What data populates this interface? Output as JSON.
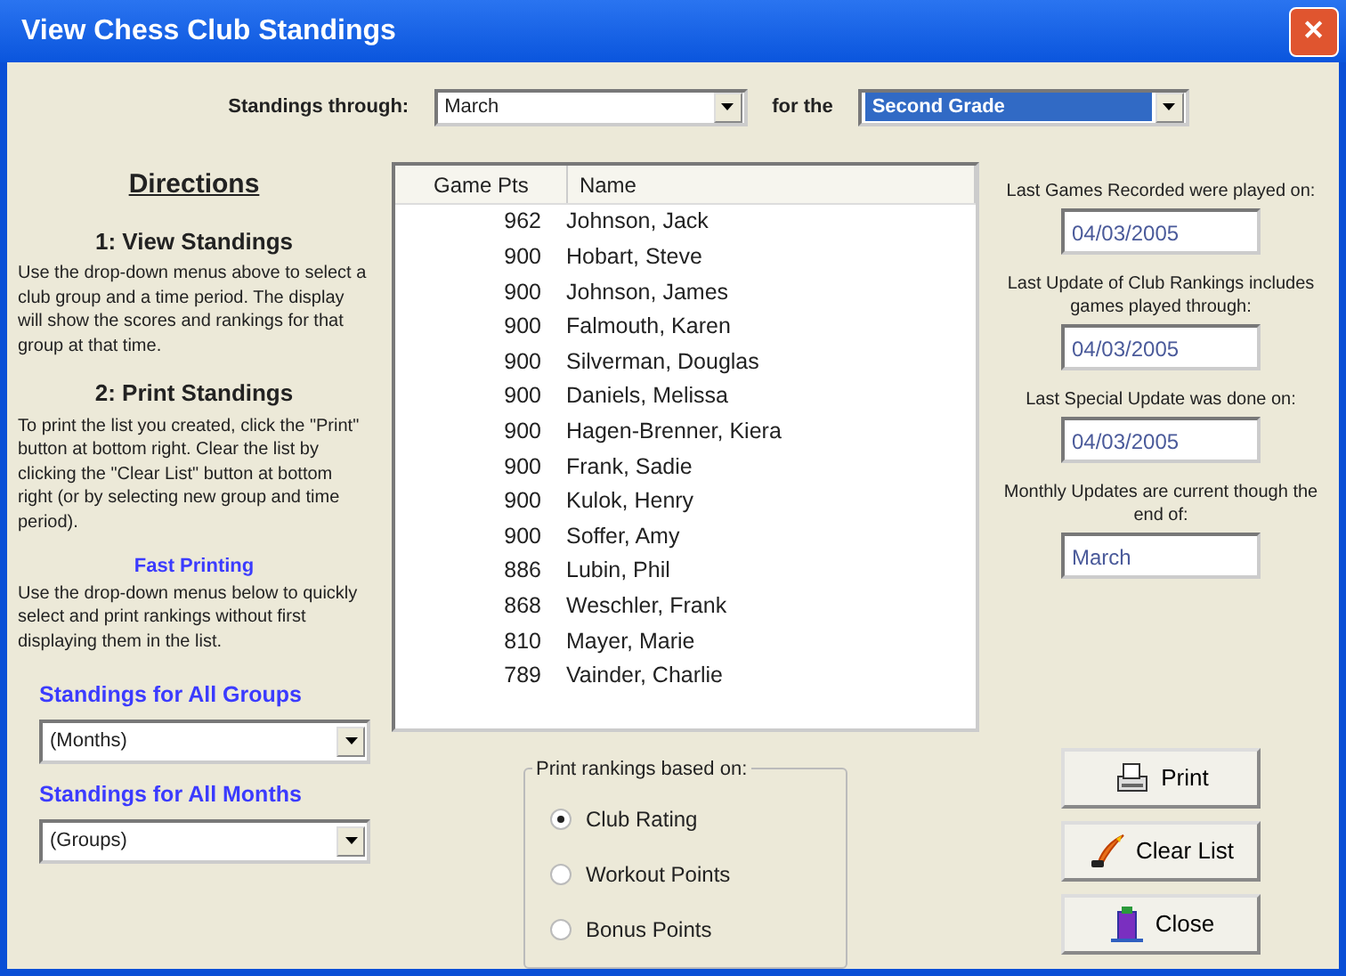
{
  "window": {
    "title": "View Chess Club Standings",
    "close": "✕"
  },
  "filters": {
    "through_label": "Standings through:",
    "through_value": "March",
    "for_label": "for the",
    "group_value": "Second Grade",
    "group_focused": true
  },
  "directions": {
    "title": "Directions",
    "sections": [
      {
        "heading": "1: View Standings",
        "text": "Use the drop-down menus above to select a club group and a time period. The display will show the scores and rankings for that group at that time."
      },
      {
        "heading": "2: Print Standings",
        "text": "To print the list you created, click the \"Print\" button at bottom right. Clear the list by clicking the \"Clear List\" button at bottom right (or by selecting new group and time period)."
      }
    ],
    "fast_heading": "Fast Printing",
    "fast_text": "Use the drop-down menus below to quickly select and print rankings without first displaying them in the list.",
    "dropdowns": [
      {
        "label": "Standings for All Groups",
        "value": "(Months)"
      },
      {
        "label": "Standings for All Months",
        "value": "(Groups)"
      }
    ]
  },
  "table": {
    "columns": [
      "Game Pts",
      "Name"
    ],
    "rows": [
      [
        "962",
        "Johnson, Jack"
      ],
      [
        "900",
        "Hobart, Steve"
      ],
      [
        "900",
        "Johnson, James"
      ],
      [
        "900",
        "Falmouth, Karen"
      ],
      [
        "900",
        "Silverman, Douglas"
      ],
      [
        "900",
        "Daniels, Melissa"
      ],
      [
        "900",
        "Hagen-Brenner, Kiera"
      ],
      [
        "900",
        "Frank, Sadie"
      ],
      [
        "900",
        "Kulok, Henry"
      ],
      [
        "900",
        "Soffer, Amy"
      ],
      [
        "886",
        "Lubin, Phil"
      ],
      [
        "868",
        "Weschler, Frank"
      ],
      [
        "810",
        "Mayer, Marie"
      ],
      [
        "789",
        "Vainder, Charlie"
      ]
    ]
  },
  "print_basis": {
    "legend": "Print rankings based on:",
    "options": [
      {
        "label": "Club Rating",
        "selected": true
      },
      {
        "label": "Workout Points",
        "selected": false
      },
      {
        "label": "Bonus Points",
        "selected": false
      }
    ]
  },
  "info_fields": [
    {
      "label": "Last Games Recorded were played on:",
      "value": "04/03/2005"
    },
    {
      "label": "Last Update of Club Rankings includes games played through:",
      "value": "04/03/2005"
    },
    {
      "label": "Last Special Update was done on:",
      "value": "04/03/2005"
    },
    {
      "label": "Monthly Updates are current though the end of:",
      "value": "March"
    }
  ],
  "buttons": [
    {
      "kind": "print",
      "label": "Print"
    },
    {
      "kind": "clear",
      "label": "Clear List"
    },
    {
      "kind": "close",
      "label": "Close"
    }
  ]
}
